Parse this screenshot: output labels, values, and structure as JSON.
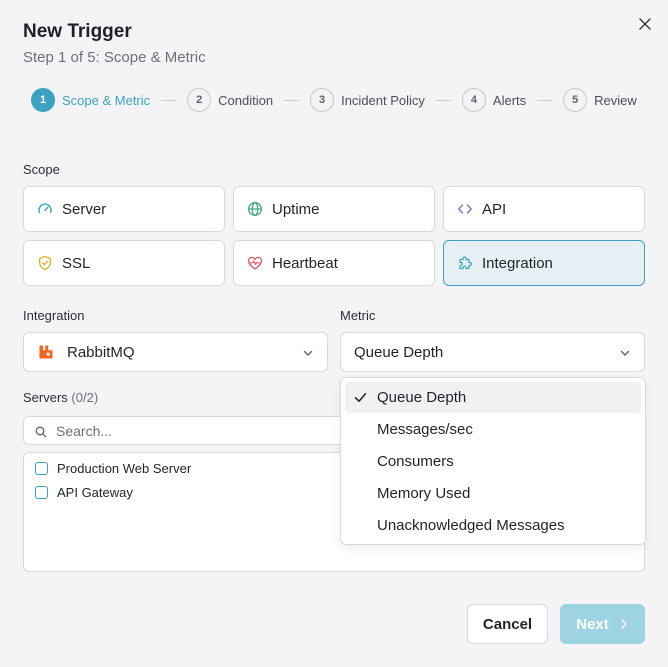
{
  "dialog": {
    "title": "New Trigger",
    "subtitle": "Step 1 of 5: Scope & Metric",
    "close_icon": "close-icon"
  },
  "steps": [
    {
      "num": "1",
      "label": "Scope & Metric",
      "active": true
    },
    {
      "num": "2",
      "label": "Condition",
      "active": false
    },
    {
      "num": "3",
      "label": "Incident Policy",
      "active": false
    },
    {
      "num": "4",
      "label": "Alerts",
      "active": false
    },
    {
      "num": "5",
      "label": "Review",
      "active": false
    }
  ],
  "scope": {
    "label": "Scope",
    "options": [
      {
        "label": "Server",
        "icon": "gauge-icon",
        "selected": false
      },
      {
        "label": "Uptime",
        "icon": "globe-icon",
        "selected": false
      },
      {
        "label": "API",
        "icon": "code-icon",
        "selected": false
      },
      {
        "label": "SSL",
        "icon": "shield-check-icon",
        "selected": false
      },
      {
        "label": "Heartbeat",
        "icon": "heart-pulse-icon",
        "selected": false
      },
      {
        "label": "Integration",
        "icon": "puzzle-icon",
        "selected": true
      }
    ]
  },
  "integration": {
    "label": "Integration",
    "value": "RabbitMQ",
    "icon": "rabbitmq-logo-icon"
  },
  "metric": {
    "label": "Metric",
    "value": "Queue Depth",
    "options": [
      {
        "label": "Queue Depth",
        "selected": true
      },
      {
        "label": "Messages/sec",
        "selected": false
      },
      {
        "label": "Consumers",
        "selected": false
      },
      {
        "label": "Memory Used",
        "selected": false
      },
      {
        "label": "Unacknowledged Messages",
        "selected": false
      }
    ]
  },
  "servers": {
    "label": "Servers",
    "count": "(0/2)",
    "search_placeholder": "Search...",
    "items": [
      {
        "name": "Production Web Server",
        "checked": false
      },
      {
        "name": "API Gateway",
        "checked": false
      }
    ]
  },
  "footer": {
    "cancel_label": "Cancel",
    "next_label": "Next"
  },
  "colors": {
    "accent": "#3aa2c2",
    "accent_disabled": "#9dd3e3",
    "rabbitmq": "#f26522",
    "heart": "#e05565",
    "shield": "#e0b020",
    "globe": "#3aa872",
    "code": "#7b6fd0"
  }
}
